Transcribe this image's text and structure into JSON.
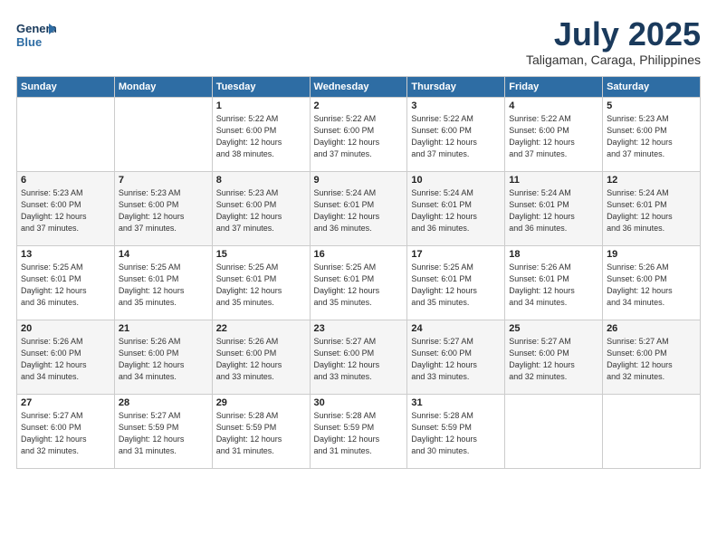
{
  "logo": {
    "line1": "General",
    "line2": "Blue"
  },
  "title": "July 2025",
  "subtitle": "Taligaman, Caraga, Philippines",
  "days_of_week": [
    "Sunday",
    "Monday",
    "Tuesday",
    "Wednesday",
    "Thursday",
    "Friday",
    "Saturday"
  ],
  "weeks": [
    [
      {
        "day": "",
        "info": ""
      },
      {
        "day": "",
        "info": ""
      },
      {
        "day": "1",
        "info": "Sunrise: 5:22 AM\nSunset: 6:00 PM\nDaylight: 12 hours\nand 38 minutes."
      },
      {
        "day": "2",
        "info": "Sunrise: 5:22 AM\nSunset: 6:00 PM\nDaylight: 12 hours\nand 37 minutes."
      },
      {
        "day": "3",
        "info": "Sunrise: 5:22 AM\nSunset: 6:00 PM\nDaylight: 12 hours\nand 37 minutes."
      },
      {
        "day": "4",
        "info": "Sunrise: 5:22 AM\nSunset: 6:00 PM\nDaylight: 12 hours\nand 37 minutes."
      },
      {
        "day": "5",
        "info": "Sunrise: 5:23 AM\nSunset: 6:00 PM\nDaylight: 12 hours\nand 37 minutes."
      }
    ],
    [
      {
        "day": "6",
        "info": "Sunrise: 5:23 AM\nSunset: 6:00 PM\nDaylight: 12 hours\nand 37 minutes."
      },
      {
        "day": "7",
        "info": "Sunrise: 5:23 AM\nSunset: 6:00 PM\nDaylight: 12 hours\nand 37 minutes."
      },
      {
        "day": "8",
        "info": "Sunrise: 5:23 AM\nSunset: 6:00 PM\nDaylight: 12 hours\nand 37 minutes."
      },
      {
        "day": "9",
        "info": "Sunrise: 5:24 AM\nSunset: 6:01 PM\nDaylight: 12 hours\nand 36 minutes."
      },
      {
        "day": "10",
        "info": "Sunrise: 5:24 AM\nSunset: 6:01 PM\nDaylight: 12 hours\nand 36 minutes."
      },
      {
        "day": "11",
        "info": "Sunrise: 5:24 AM\nSunset: 6:01 PM\nDaylight: 12 hours\nand 36 minutes."
      },
      {
        "day": "12",
        "info": "Sunrise: 5:24 AM\nSunset: 6:01 PM\nDaylight: 12 hours\nand 36 minutes."
      }
    ],
    [
      {
        "day": "13",
        "info": "Sunrise: 5:25 AM\nSunset: 6:01 PM\nDaylight: 12 hours\nand 36 minutes."
      },
      {
        "day": "14",
        "info": "Sunrise: 5:25 AM\nSunset: 6:01 PM\nDaylight: 12 hours\nand 35 minutes."
      },
      {
        "day": "15",
        "info": "Sunrise: 5:25 AM\nSunset: 6:01 PM\nDaylight: 12 hours\nand 35 minutes."
      },
      {
        "day": "16",
        "info": "Sunrise: 5:25 AM\nSunset: 6:01 PM\nDaylight: 12 hours\nand 35 minutes."
      },
      {
        "day": "17",
        "info": "Sunrise: 5:25 AM\nSunset: 6:01 PM\nDaylight: 12 hours\nand 35 minutes."
      },
      {
        "day": "18",
        "info": "Sunrise: 5:26 AM\nSunset: 6:01 PM\nDaylight: 12 hours\nand 34 minutes."
      },
      {
        "day": "19",
        "info": "Sunrise: 5:26 AM\nSunset: 6:00 PM\nDaylight: 12 hours\nand 34 minutes."
      }
    ],
    [
      {
        "day": "20",
        "info": "Sunrise: 5:26 AM\nSunset: 6:00 PM\nDaylight: 12 hours\nand 34 minutes."
      },
      {
        "day": "21",
        "info": "Sunrise: 5:26 AM\nSunset: 6:00 PM\nDaylight: 12 hours\nand 34 minutes."
      },
      {
        "day": "22",
        "info": "Sunrise: 5:26 AM\nSunset: 6:00 PM\nDaylight: 12 hours\nand 33 minutes."
      },
      {
        "day": "23",
        "info": "Sunrise: 5:27 AM\nSunset: 6:00 PM\nDaylight: 12 hours\nand 33 minutes."
      },
      {
        "day": "24",
        "info": "Sunrise: 5:27 AM\nSunset: 6:00 PM\nDaylight: 12 hours\nand 33 minutes."
      },
      {
        "day": "25",
        "info": "Sunrise: 5:27 AM\nSunset: 6:00 PM\nDaylight: 12 hours\nand 32 minutes."
      },
      {
        "day": "26",
        "info": "Sunrise: 5:27 AM\nSunset: 6:00 PM\nDaylight: 12 hours\nand 32 minutes."
      }
    ],
    [
      {
        "day": "27",
        "info": "Sunrise: 5:27 AM\nSunset: 6:00 PM\nDaylight: 12 hours\nand 32 minutes."
      },
      {
        "day": "28",
        "info": "Sunrise: 5:27 AM\nSunset: 5:59 PM\nDaylight: 12 hours\nand 31 minutes."
      },
      {
        "day": "29",
        "info": "Sunrise: 5:28 AM\nSunset: 5:59 PM\nDaylight: 12 hours\nand 31 minutes."
      },
      {
        "day": "30",
        "info": "Sunrise: 5:28 AM\nSunset: 5:59 PM\nDaylight: 12 hours\nand 31 minutes."
      },
      {
        "day": "31",
        "info": "Sunrise: 5:28 AM\nSunset: 5:59 PM\nDaylight: 12 hours\nand 30 minutes."
      },
      {
        "day": "",
        "info": ""
      },
      {
        "day": "",
        "info": ""
      }
    ]
  ]
}
